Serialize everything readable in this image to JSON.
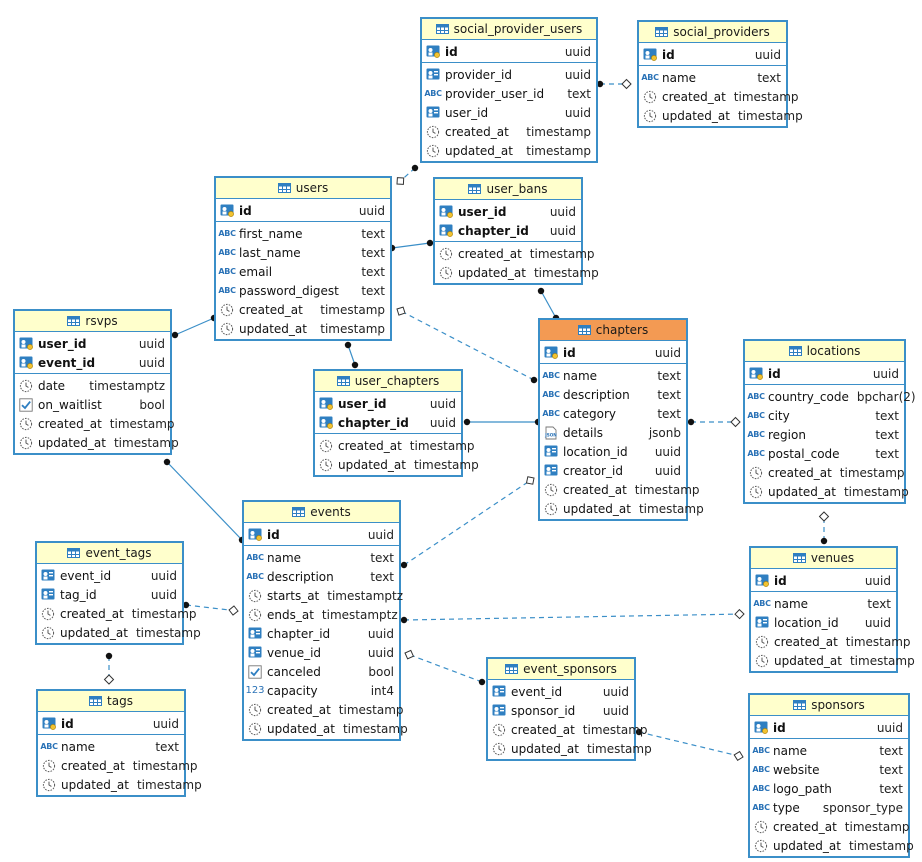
{
  "colors": {
    "border": "#3b8fc8",
    "header": "#ffffcc",
    "focus_header": "#f39a53",
    "icon": "#2b73b7"
  },
  "tables": [
    {
      "key": "social_provider_users",
      "title": "social_provider_users",
      "pk": [
        {
          "name": "id",
          "type": "uuid",
          "icon": "key-icon"
        }
      ],
      "cols": [
        {
          "name": "provider_id",
          "type": "uuid",
          "icon": "fk-icon"
        },
        {
          "name": "provider_user_id",
          "type": "text",
          "icon": "abc-icon"
        },
        {
          "name": "user_id",
          "type": "uuid",
          "icon": "fk-icon"
        },
        {
          "name": "created_at",
          "type": "timestamp",
          "icon": "clock-icon"
        },
        {
          "name": "updated_at",
          "type": "timestamp",
          "icon": "clock-icon"
        }
      ]
    },
    {
      "key": "social_providers",
      "title": "social_providers",
      "pk": [
        {
          "name": "id",
          "type": "uuid",
          "icon": "key-icon"
        }
      ],
      "cols": [
        {
          "name": "name",
          "type": "text",
          "icon": "abc-icon"
        },
        {
          "name": "created_at",
          "type": "timestamp",
          "icon": "clock-icon"
        },
        {
          "name": "updated_at",
          "type": "timestamp",
          "icon": "clock-icon"
        }
      ]
    },
    {
      "key": "users",
      "title": "users",
      "pk": [
        {
          "name": "id",
          "type": "uuid",
          "icon": "key-icon"
        }
      ],
      "cols": [
        {
          "name": "first_name",
          "type": "text",
          "icon": "abc-icon"
        },
        {
          "name": "last_name",
          "type": "text",
          "icon": "abc-icon"
        },
        {
          "name": "email",
          "type": "text",
          "icon": "abc-icon"
        },
        {
          "name": "password_digest",
          "type": "text",
          "icon": "abc-icon"
        },
        {
          "name": "created_at",
          "type": "timestamp",
          "icon": "clock-icon"
        },
        {
          "name": "updated_at",
          "type": "timestamp",
          "icon": "clock-icon"
        }
      ]
    },
    {
      "key": "user_bans",
      "title": "user_bans",
      "pk": [
        {
          "name": "user_id",
          "type": "uuid",
          "icon": "key-icon"
        },
        {
          "name": "chapter_id",
          "type": "uuid",
          "icon": "key-icon"
        }
      ],
      "cols": [
        {
          "name": "created_at",
          "type": "timestamp",
          "icon": "clock-icon"
        },
        {
          "name": "updated_at",
          "type": "timestamp",
          "icon": "clock-icon"
        }
      ]
    },
    {
      "key": "rsvps",
      "title": "rsvps",
      "pk": [
        {
          "name": "user_id",
          "type": "uuid",
          "icon": "key-icon"
        },
        {
          "name": "event_id",
          "type": "uuid",
          "icon": "key-icon"
        }
      ],
      "cols": [
        {
          "name": "date",
          "type": "timestamptz",
          "icon": "clock-icon"
        },
        {
          "name": "on_waitlist",
          "type": "bool",
          "icon": "check-icon"
        },
        {
          "name": "created_at",
          "type": "timestamp",
          "icon": "clock-icon"
        },
        {
          "name": "updated_at",
          "type": "timestamp",
          "icon": "clock-icon"
        }
      ]
    },
    {
      "key": "user_chapters",
      "title": "user_chapters",
      "pk": [
        {
          "name": "user_id",
          "type": "uuid",
          "icon": "key-icon"
        },
        {
          "name": "chapter_id",
          "type": "uuid",
          "icon": "key-icon"
        }
      ],
      "cols": [
        {
          "name": "created_at",
          "type": "timestamp",
          "icon": "clock-icon"
        },
        {
          "name": "updated_at",
          "type": "timestamp",
          "icon": "clock-icon"
        }
      ]
    },
    {
      "key": "chapters",
      "title": "chapters",
      "pk": [
        {
          "name": "id",
          "type": "uuid",
          "icon": "key-icon"
        }
      ],
      "cols": [
        {
          "name": "name",
          "type": "text",
          "icon": "abc-icon"
        },
        {
          "name": "description",
          "type": "text",
          "icon": "abc-icon"
        },
        {
          "name": "category",
          "type": "text",
          "icon": "abc-icon"
        },
        {
          "name": "details",
          "type": "jsonb",
          "icon": "json-icon"
        },
        {
          "name": "location_id",
          "type": "uuid",
          "icon": "fk-icon"
        },
        {
          "name": "creator_id",
          "type": "uuid",
          "icon": "fk-icon"
        },
        {
          "name": "created_at",
          "type": "timestamp",
          "icon": "clock-icon"
        },
        {
          "name": "updated_at",
          "type": "timestamp",
          "icon": "clock-icon"
        }
      ]
    },
    {
      "key": "locations",
      "title": "locations",
      "pk": [
        {
          "name": "id",
          "type": "uuid",
          "icon": "key-icon"
        }
      ],
      "cols": [
        {
          "name": "country_code",
          "type": "bpchar(2)",
          "icon": "abc-icon"
        },
        {
          "name": "city",
          "type": "text",
          "icon": "abc-icon"
        },
        {
          "name": "region",
          "type": "text",
          "icon": "abc-icon"
        },
        {
          "name": "postal_code",
          "type": "text",
          "icon": "abc-icon"
        },
        {
          "name": "created_at",
          "type": "timestamp",
          "icon": "clock-icon"
        },
        {
          "name": "updated_at",
          "type": "timestamp",
          "icon": "clock-icon"
        }
      ]
    },
    {
      "key": "event_tags",
      "title": "event_tags",
      "pk": [],
      "cols": [
        {
          "name": "event_id",
          "type": "uuid",
          "icon": "fk-icon"
        },
        {
          "name": "tag_id",
          "type": "uuid",
          "icon": "fk-icon"
        },
        {
          "name": "created_at",
          "type": "timestamp",
          "icon": "clock-icon"
        },
        {
          "name": "updated_at",
          "type": "timestamp",
          "icon": "clock-icon"
        }
      ]
    },
    {
      "key": "events",
      "title": "events",
      "pk": [
        {
          "name": "id",
          "type": "uuid",
          "icon": "key-icon"
        }
      ],
      "cols": [
        {
          "name": "name",
          "type": "text",
          "icon": "abc-icon"
        },
        {
          "name": "description",
          "type": "text",
          "icon": "abc-icon"
        },
        {
          "name": "starts_at",
          "type": "timestamptz",
          "icon": "clock-icon"
        },
        {
          "name": "ends_at",
          "type": "timestamptz",
          "icon": "clock-icon"
        },
        {
          "name": "chapter_id",
          "type": "uuid",
          "icon": "fk-icon"
        },
        {
          "name": "venue_id",
          "type": "uuid",
          "icon": "fk-icon"
        },
        {
          "name": "canceled",
          "type": "bool",
          "icon": "check-icon"
        },
        {
          "name": "capacity",
          "type": "int4",
          "icon": "num-icon"
        },
        {
          "name": "created_at",
          "type": "timestamp",
          "icon": "clock-icon"
        },
        {
          "name": "updated_at",
          "type": "timestamp",
          "icon": "clock-icon"
        }
      ]
    },
    {
      "key": "venues",
      "title": "venues",
      "pk": [
        {
          "name": "id",
          "type": "uuid",
          "icon": "key-icon"
        }
      ],
      "cols": [
        {
          "name": "name",
          "type": "text",
          "icon": "abc-icon"
        },
        {
          "name": "location_id",
          "type": "uuid",
          "icon": "fk-icon"
        },
        {
          "name": "created_at",
          "type": "timestamp",
          "icon": "clock-icon"
        },
        {
          "name": "updated_at",
          "type": "timestamp",
          "icon": "clock-icon"
        }
      ]
    },
    {
      "key": "event_sponsors",
      "title": "event_sponsors",
      "pk": [],
      "cols": [
        {
          "name": "event_id",
          "type": "uuid",
          "icon": "fk-icon"
        },
        {
          "name": "sponsor_id",
          "type": "uuid",
          "icon": "fk-icon"
        },
        {
          "name": "created_at",
          "type": "timestamp",
          "icon": "clock-icon"
        },
        {
          "name": "updated_at",
          "type": "timestamp",
          "icon": "clock-icon"
        }
      ]
    },
    {
      "key": "tags",
      "title": "tags",
      "pk": [
        {
          "name": "id",
          "type": "uuid",
          "icon": "key-icon"
        }
      ],
      "cols": [
        {
          "name": "name",
          "type": "text",
          "icon": "abc-icon"
        },
        {
          "name": "created_at",
          "type": "timestamp",
          "icon": "clock-icon"
        },
        {
          "name": "updated_at",
          "type": "timestamp",
          "icon": "clock-icon"
        }
      ]
    },
    {
      "key": "sponsors",
      "title": "sponsors",
      "pk": [
        {
          "name": "id",
          "type": "uuid",
          "icon": "key-icon"
        }
      ],
      "cols": [
        {
          "name": "name",
          "type": "text",
          "icon": "abc-icon"
        },
        {
          "name": "website",
          "type": "text",
          "icon": "abc-icon"
        },
        {
          "name": "logo_path",
          "type": "text",
          "icon": "abc-icon"
        },
        {
          "name": "type",
          "type": "sponsor_type",
          "icon": "abc-icon"
        },
        {
          "name": "created_at",
          "type": "timestamp",
          "icon": "clock-icon"
        },
        {
          "name": "updated_at",
          "type": "timestamp",
          "icon": "clock-icon"
        }
      ]
    }
  ],
  "relations": [
    {
      "from": "social_provider_users",
      "to": "social_providers",
      "identifying": false
    },
    {
      "from": "social_provider_users",
      "to": "users",
      "identifying": false
    },
    {
      "from": "user_bans",
      "to": "users",
      "identifying": true
    },
    {
      "from": "user_bans",
      "to": "chapters",
      "identifying": true
    },
    {
      "from": "rsvps",
      "to": "users",
      "identifying": true
    },
    {
      "from": "rsvps",
      "to": "events",
      "identifying": true
    },
    {
      "from": "user_chapters",
      "to": "users",
      "identifying": true
    },
    {
      "from": "user_chapters",
      "to": "chapters",
      "identifying": true
    },
    {
      "from": "chapters",
      "to": "users",
      "identifying": false
    },
    {
      "from": "chapters",
      "to": "locations",
      "identifying": false
    },
    {
      "from": "events",
      "to": "chapters",
      "identifying": false
    },
    {
      "from": "events",
      "to": "venues",
      "identifying": false
    },
    {
      "from": "event_tags",
      "to": "events",
      "identifying": false
    },
    {
      "from": "event_tags",
      "to": "tags",
      "identifying": false
    },
    {
      "from": "event_sponsors",
      "to": "events",
      "identifying": false
    },
    {
      "from": "event_sponsors",
      "to": "sponsors",
      "identifying": false
    },
    {
      "from": "venues",
      "to": "locations",
      "identifying": false
    }
  ]
}
